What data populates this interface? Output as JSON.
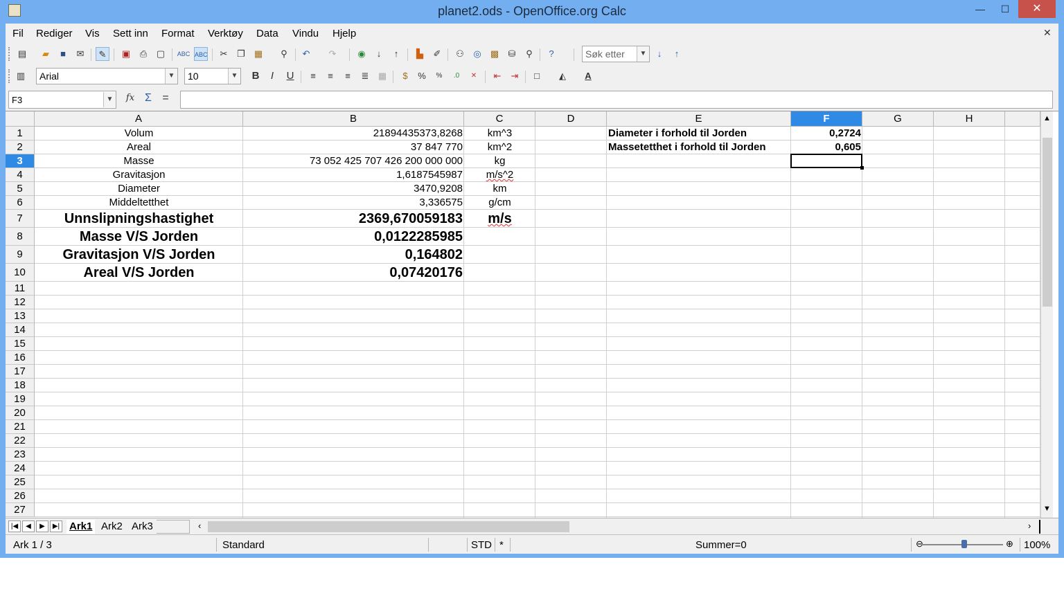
{
  "window": {
    "title": "planet2.ods - OpenOffice.org Calc",
    "minimize": "—",
    "maximize": "☐",
    "close": "✕"
  },
  "menu": [
    "Fil",
    "Rediger",
    "Vis",
    "Sett inn",
    "Format",
    "Verktøy",
    "Data",
    "Vindu",
    "Hjelp"
  ],
  "toolbar": {
    "search_placeholder": "Søk etter"
  },
  "formatting": {
    "font_name": "Arial",
    "font_size": "10"
  },
  "formula_bar": {
    "name_box": "F3",
    "fx": "fx",
    "sum": "Σ",
    "equals": "="
  },
  "columns": [
    "A",
    "B",
    "C",
    "D",
    "E",
    "F",
    "G",
    "H"
  ],
  "selected_column": "F",
  "selected_row": 3,
  "rows": [
    "1",
    "2",
    "3",
    "4",
    "5",
    "6",
    "7",
    "8",
    "9",
    "10",
    "11",
    "12",
    "13",
    "14",
    "15",
    "16",
    "17",
    "18",
    "19",
    "20",
    "21",
    "22",
    "23",
    "24",
    "25",
    "26",
    "27"
  ],
  "cells": {
    "A1": "Volum",
    "B1": "21894435373,8268",
    "C1": "km^3",
    "A2": "Areal",
    "B2": "37 847 770",
    "C2": "km^2",
    "A3": "Masse",
    "B3": "73 052 425 707 426 200 000 000",
    "C3": "kg",
    "A4": "Gravitasjon",
    "B4": "1,6187545987",
    "C4": "m/s^2",
    "A5": "Diameter",
    "B5": "3470,9208",
    "C5": "km",
    "A6": "Middeltetthet",
    "B6": "3,336575",
    "C6": "g/cm",
    "A7": "Unnslipningshastighet",
    "B7": "2369,670059183",
    "C7": "m/s",
    "A8": "Masse V/S Jorden",
    "B8": "0,0122285985",
    "A9": "Gravitasjon V/S Jorden",
    "B9": "0,164802",
    "A10": "Areal V/S Jorden",
    "B10": "0,07420176",
    "E1": "Diameter i forhold til Jorden",
    "F1": "0,2724",
    "E2": "Massetetthet i forhold til Jorden",
    "F2": "0,605"
  },
  "sheets": [
    "Ark1",
    "Ark2",
    "Ark3"
  ],
  "active_sheet": "Ark1",
  "status": {
    "sheet": "Ark 1 / 3",
    "style": "Standard",
    "mode": "STD",
    "modified": "*",
    "sum": "Summer=0",
    "zoom": "100%"
  }
}
